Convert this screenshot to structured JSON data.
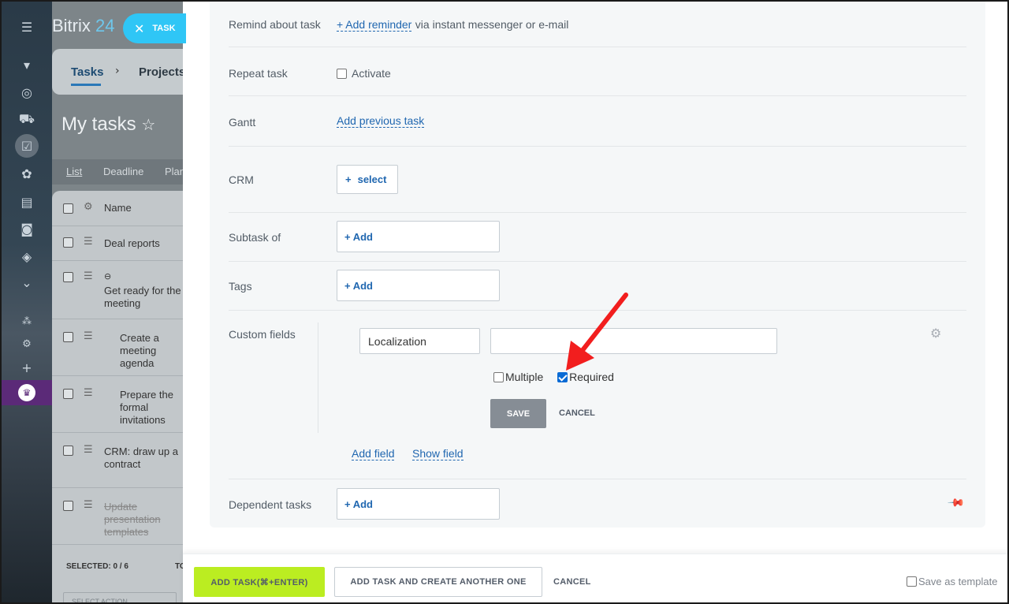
{
  "background_app": {
    "logo_text": "Bitrix",
    "logo_num": "24",
    "nav_tasks": "Tasks",
    "nav_sep": "›",
    "nav_projects": "Projects",
    "title": "My tasks",
    "title_star": "☆",
    "views": [
      "List",
      "Deadline",
      "Plan"
    ],
    "header_name": "Name",
    "tasks": [
      {
        "lines": [
          "Deal reports"
        ],
        "strike": false
      },
      {
        "lines": [
          "Get ready for the",
          "meeting"
        ],
        "strike": false
      },
      {
        "lines": [
          "Create a",
          "meeting",
          "agenda"
        ],
        "strike": false
      },
      {
        "lines": [
          "Prepare the",
          "formal",
          "invitations"
        ],
        "strike": false
      },
      {
        "lines": [
          "CRM: draw up a",
          "contract"
        ],
        "strike": false
      },
      {
        "lines": [
          "Update",
          "presentation",
          "templates"
        ],
        "strike": true
      }
    ],
    "selected": "SELECTED: 0 / 6",
    "select_action": "SELECT ACTION",
    "total_abbr": "TO"
  },
  "task_chip": {
    "label": "TASK",
    "close": "✕"
  },
  "form": {
    "remind": {
      "label": "Remind about task",
      "link": "+ Add reminder",
      "suffix": "via instant messenger or e-mail"
    },
    "repeat": {
      "label": "Repeat task",
      "checkbox": "Activate"
    },
    "gantt": {
      "label": "Gantt",
      "link": "Add previous task"
    },
    "crm": {
      "label": "CRM",
      "button_plus": "+",
      "button": "select"
    },
    "subtask": {
      "label": "Subtask of",
      "button": "+ Add"
    },
    "tags": {
      "label": "Tags",
      "button": "+ Add"
    },
    "custom_fields": {
      "label": "Custom fields",
      "field_name": "Localization",
      "field_value": "",
      "multiple_label": "Multiple",
      "multiple_checked": false,
      "required_label": "Required",
      "required_checked": true,
      "save": "SAVE",
      "cancel": "CANCEL",
      "add_field": "Add field",
      "show_field": "Show field"
    },
    "dependent": {
      "label": "Dependent tasks",
      "button": "+ Add"
    }
  },
  "footer": {
    "add_task": "ADD TASK(⌘+ENTER)",
    "add_another": "ADD TASK AND CREATE ANOTHER ONE",
    "cancel": "CANCEL",
    "save_template": "Save as template"
  },
  "colors": {
    "accent": "#2067b0",
    "add_button": "#bbed21",
    "chip": "#2fc6f6",
    "arrow": "#f21e1e"
  }
}
